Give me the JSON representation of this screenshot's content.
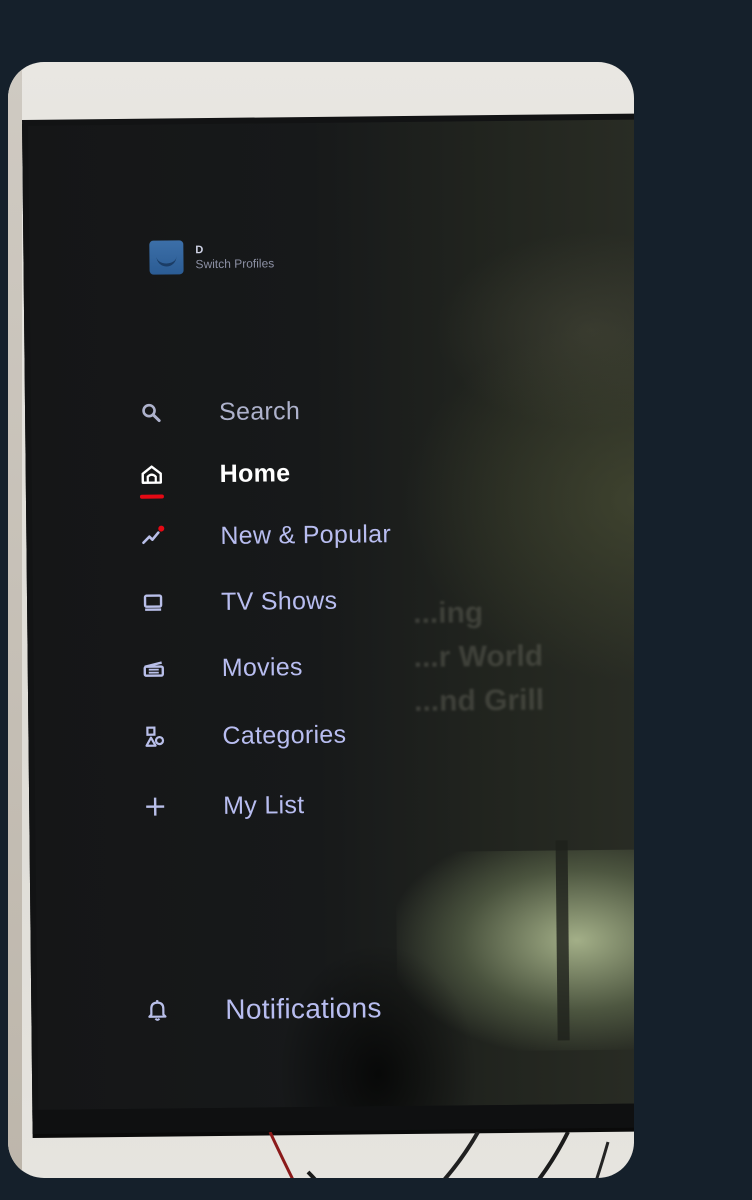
{
  "profile": {
    "name": "D",
    "switch_label": "Switch Profiles"
  },
  "menu": {
    "items": [
      {
        "label": "Search",
        "icon": "search-icon"
      },
      {
        "label": "Home",
        "icon": "home-icon",
        "active": true
      },
      {
        "label": "New & Popular",
        "icon": "trending-icon"
      },
      {
        "label": "TV Shows",
        "icon": "tv-icon"
      },
      {
        "label": "Movies",
        "icon": "movie-icon"
      },
      {
        "label": "Categories",
        "icon": "categories-icon"
      },
      {
        "label": "My List",
        "icon": "plus-icon"
      }
    ],
    "notifications": {
      "label": "Notifications",
      "icon": "bell-icon"
    }
  },
  "background_title_lines": [
    "...ing",
    "...r World",
    "...nd Grill"
  ],
  "colors": {
    "menu_text": "#b8bdf0",
    "active_text": "#ffffff",
    "accent_red": "#e50914",
    "page_background": "#15202b"
  }
}
